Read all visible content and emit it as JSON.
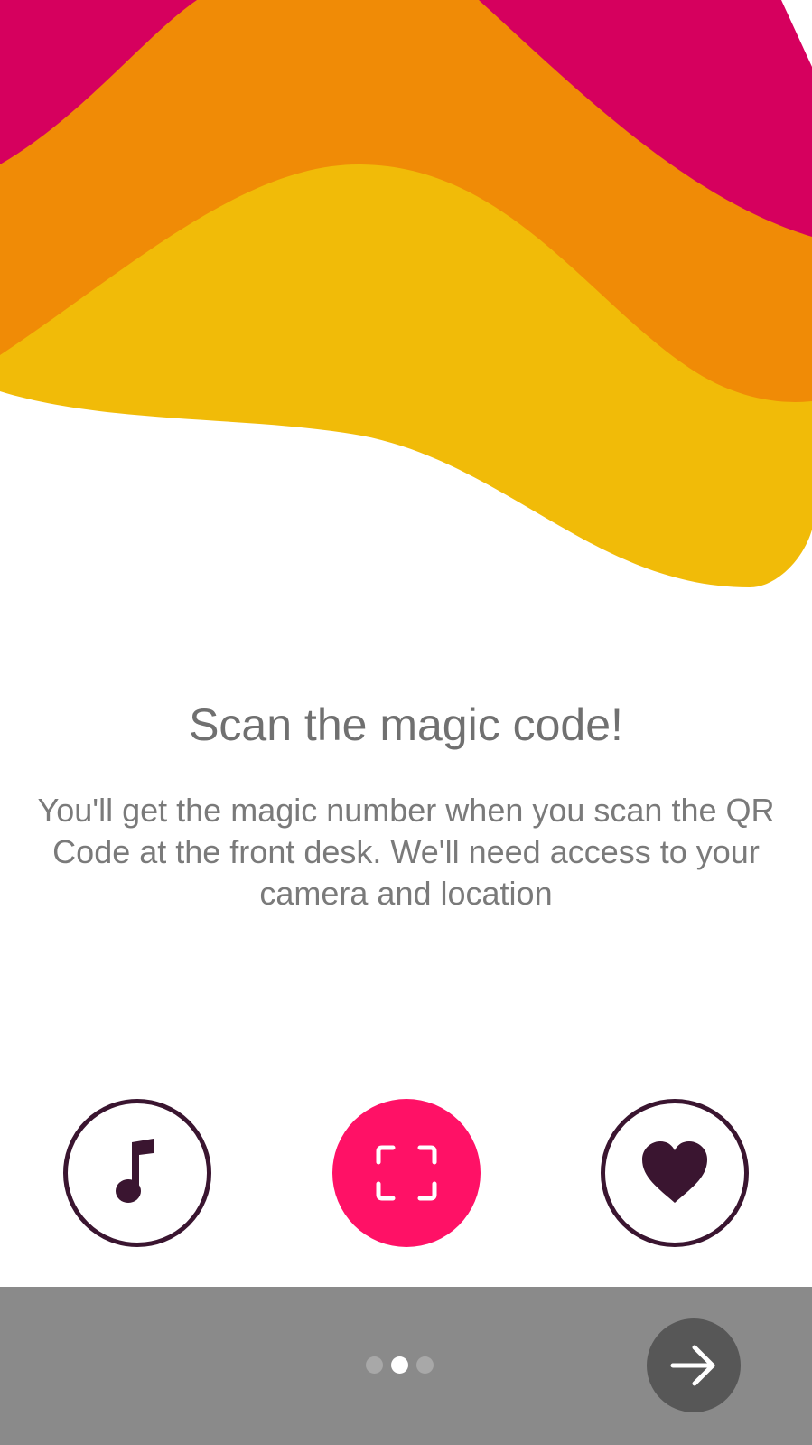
{
  "onboarding": {
    "title": "Scan the magic code!",
    "description": "You'll get the magic number when you scan the QR Code at the front desk. We'll need access to your camera and location"
  },
  "features": [
    {
      "icon": "music-note-icon",
      "selected": false
    },
    {
      "icon": "scan-frame-icon",
      "selected": true
    },
    {
      "icon": "heart-icon",
      "selected": false
    }
  ],
  "pager": {
    "total_pages": 3,
    "current_page": 2
  },
  "colors": {
    "wave_magenta": "#d6005e",
    "wave_orange": "#f08b06",
    "wave_yellow": "#f1bb08",
    "accent_pink": "#ff1166",
    "icon_dark": "#3a1530",
    "bottom_bar": "#8a8a8a",
    "next_button": "#575757"
  },
  "icons": {
    "next": "arrow-right-icon"
  }
}
